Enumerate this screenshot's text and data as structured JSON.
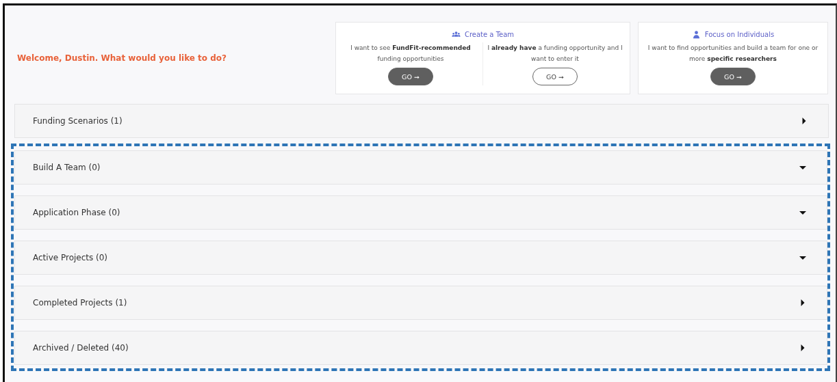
{
  "welcome": "Welcome, Dustin. What would you like to do?",
  "cards": [
    {
      "title": "Create a Team",
      "options": [
        {
          "text": "I want to see **FundFit-recommended** funding opportunities",
          "button": {
            "label": "GO ➞",
            "kind": "filled"
          }
        },
        {
          "text": "I **already have** a funding opportunity and I want to enter it",
          "button": {
            "label": "GO ➞",
            "kind": "outline"
          }
        }
      ]
    },
    {
      "title": "Focus on Individuals",
      "options": [
        {
          "text": "I want to find opportunities and build a team for one or more **specific researchers**",
          "button": {
            "label": "GO ➞",
            "kind": "filled"
          }
        }
      ]
    }
  ],
  "sections": [
    {
      "label": "Funding Scenarios (1)",
      "expanded": false,
      "highlighted": false
    },
    {
      "label": "Build A Team (0)",
      "expanded": true,
      "highlighted": true
    },
    {
      "label": "Application Phase (0)",
      "expanded": true,
      "highlighted": true
    },
    {
      "label": "Active Projects (0)",
      "expanded": true,
      "highlighted": true
    },
    {
      "label": "Completed Projects (1)",
      "expanded": false,
      "highlighted": true
    },
    {
      "label": "Archived / Deleted (40)",
      "expanded": false,
      "highlighted": true
    }
  ]
}
